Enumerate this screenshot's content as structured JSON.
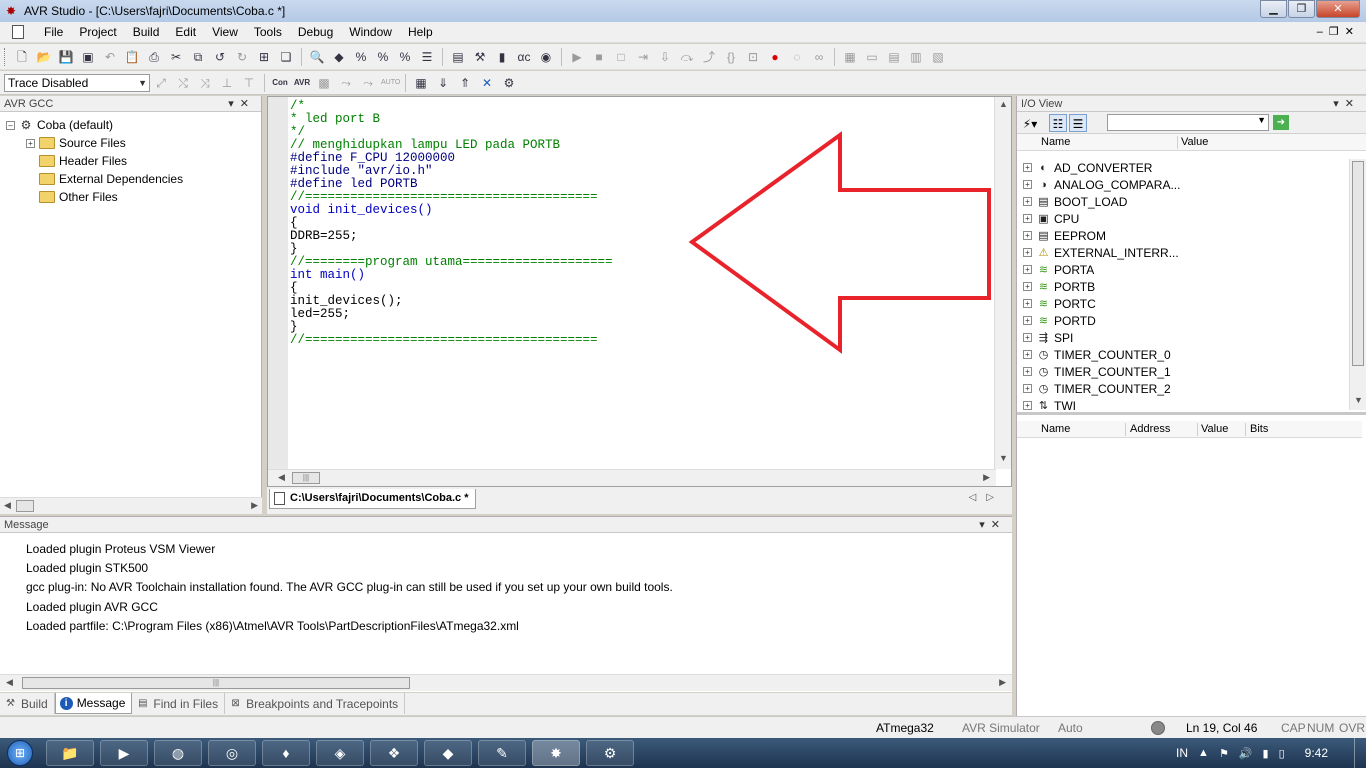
{
  "window": {
    "title": "AVR Studio - [C:\\Users\\fajri\\Documents\\Coba.c *]"
  },
  "menu": [
    "File",
    "Project",
    "Build",
    "Edit",
    "View",
    "Tools",
    "Debug",
    "Window",
    "Help"
  ],
  "toolbar2": {
    "trace_select": "Trace Disabled"
  },
  "project_panel": {
    "title": "AVR GCC",
    "root": "Coba (default)",
    "folders": [
      "Source Files",
      "Header Files",
      "External Dependencies",
      "Other Files"
    ]
  },
  "editor": {
    "tab_label": "C:\\Users\\fajri\\Documents\\Coba.c *",
    "lines": [
      {
        "text": "/*",
        "kind": "comment"
      },
      {
        "text": "* led port B",
        "kind": "comment"
      },
      {
        "text": "*/",
        "kind": "comment"
      },
      {
        "text": "// menghidupkan lampu LED pada PORTB",
        "kind": "comment"
      },
      {
        "text": "#define F_CPU 12000000",
        "kind": "pre"
      },
      {
        "text": "#include \"avr/io.h\"",
        "kind": "pre"
      },
      {
        "text": "#define led PORTB",
        "kind": "pre"
      },
      {
        "text": "//=======================================",
        "kind": "comment"
      },
      {
        "text": "void init_devices()",
        "kind": "kw"
      },
      {
        "text": "{",
        "kind": "normal"
      },
      {
        "text": "DDRB=255;",
        "kind": "normal"
      },
      {
        "text": "}",
        "kind": "normal"
      },
      {
        "text": "//========program utama====================",
        "kind": "comment"
      },
      {
        "text": "int main()",
        "kind": "kw"
      },
      {
        "text": "{",
        "kind": "normal"
      },
      {
        "text": "init_devices();",
        "kind": "normal"
      },
      {
        "text": "led=255;",
        "kind": "normal"
      },
      {
        "text": "}",
        "kind": "normal"
      },
      {
        "text": "//=======================================",
        "kind": "comment"
      }
    ]
  },
  "io_view": {
    "title": "I/O View",
    "columns": [
      "Name",
      "Value"
    ],
    "items": [
      {
        "name": "AD_CONVERTER",
        "icon": "adc-icon"
      },
      {
        "name": "ANALOG_COMPARA...",
        "icon": "comparator-icon"
      },
      {
        "name": "BOOT_LOAD",
        "icon": "memory-icon"
      },
      {
        "name": "CPU",
        "icon": "cpu-icon"
      },
      {
        "name": "EEPROM",
        "icon": "memory-icon"
      },
      {
        "name": "EXTERNAL_INTERR...",
        "icon": "interrupt-icon"
      },
      {
        "name": "PORTA",
        "icon": "port-icon"
      },
      {
        "name": "PORTB",
        "icon": "port-icon"
      },
      {
        "name": "PORTC",
        "icon": "port-icon"
      },
      {
        "name": "PORTD",
        "icon": "port-icon"
      },
      {
        "name": "SPI",
        "icon": "spi-icon"
      },
      {
        "name": "TIMER_COUNTER_0",
        "icon": "timer-icon"
      },
      {
        "name": "TIMER_COUNTER_1",
        "icon": "timer-icon"
      },
      {
        "name": "TIMER_COUNTER_2",
        "icon": "timer-icon"
      },
      {
        "name": "TWI",
        "icon": "twi-icon"
      }
    ],
    "bits_columns": [
      "Name",
      "Address",
      "Value",
      "Bits"
    ]
  },
  "message_panel": {
    "title": "Message",
    "lines": [
      "Loaded plugin Proteus VSM Viewer",
      "Loaded plugin STK500",
      "gcc plug-in: No AVR Toolchain installation found. The AVR GCC plug-in can still be used if you set up your own build tools.",
      "Loaded plugin AVR GCC",
      "Loaded partfile: C:\\Program Files (x86)\\Atmel\\AVR Tools\\PartDescriptionFiles\\ATmega32.xml"
    ]
  },
  "bottom_tabs": [
    {
      "label": "Build",
      "active": false
    },
    {
      "label": "Message",
      "active": true
    },
    {
      "label": "Find in Files",
      "active": false
    },
    {
      "label": "Breakpoints and Tracepoints",
      "active": false
    }
  ],
  "status": {
    "device": "ATmega32",
    "platform": "AVR Simulator",
    "mode": "Auto",
    "position": "Ln 19, Col 46",
    "caps": "CAP",
    "num": "NUM",
    "ovr": "OVR"
  },
  "taskbar": {
    "lang": "IN",
    "clock": "9:42"
  },
  "colors": {
    "annotation_arrow": "#e8232b",
    "comment": "#008000",
    "keyword": "#0000c0"
  }
}
